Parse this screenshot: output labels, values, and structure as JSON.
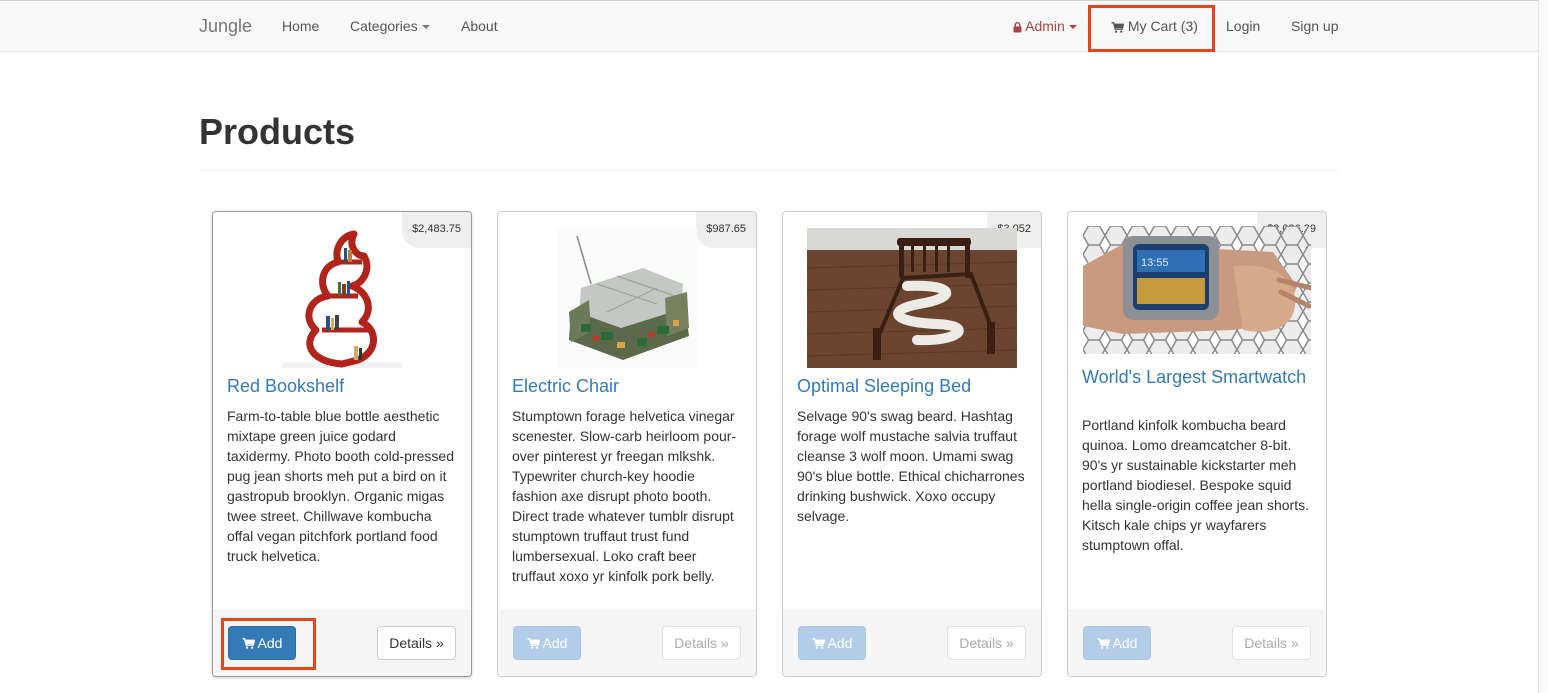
{
  "navbar": {
    "brand": "Jungle",
    "home": "Home",
    "categories": "Categories",
    "about": "About",
    "admin": "Admin",
    "cart": "My Cart (3)",
    "login": "Login",
    "signup": "Sign up"
  },
  "page": {
    "title": "Products"
  },
  "products": [
    {
      "price": "$2,483.75",
      "name": "Red Bookshelf",
      "description": "Farm-to-table blue bottle aesthetic mixtape green juice godard taxidermy. Photo booth cold-pressed pug jean shorts meh put a bird on it gastropub brooklyn. Organic migas twee street. Chillwave kombucha offal vegan pitchfork portland food truck helvetica.",
      "add_label": "Add",
      "details_label": "Details »"
    },
    {
      "price": "$987.65",
      "name": "Electric Chair",
      "description": "Stumptown forage helvetica vinegar scenester. Slow-carb heirloom pour-over pinterest yr freegan mlkshk. Typewriter church-key hoodie fashion axe disrupt photo booth. Direct trade whatever tumblr disrupt stumptown truffaut trust fund lumbersexual. Loko craft beer truffaut xoxo yr kinfolk pork belly.",
      "add_label": "Add",
      "details_label": "Details »"
    },
    {
      "price": "$3,052",
      "name": "Optimal Sleeping Bed",
      "description": "Selvage 90's swag beard. Hashtag forage wolf mustache salvia truffaut cleanse 3 wolf moon. Umami swag 90's blue bottle. Ethical chicharrones drinking bushwick. Xoxo occupy selvage.",
      "add_label": "Add",
      "details_label": "Details »"
    },
    {
      "price": "$2,026.29",
      "name": "World's Largest Smartwatch",
      "description": "Portland kinfolk kombucha beard quinoa. Lomo dreamcatcher 8-bit. 90's yr sustainable kickstarter meh portland biodiesel. Bespoke squid hella single-origin coffee jean shorts. Kitsch kale chips yr wayfarers stumptown offal.",
      "add_label": "Add",
      "details_label": "Details »"
    }
  ],
  "colors": {
    "link": "#337ab7",
    "primary": "#337ab7",
    "highlight": "#e8431d",
    "admin": "#a94442"
  },
  "icons": [
    "lock-icon",
    "cart-icon"
  ]
}
